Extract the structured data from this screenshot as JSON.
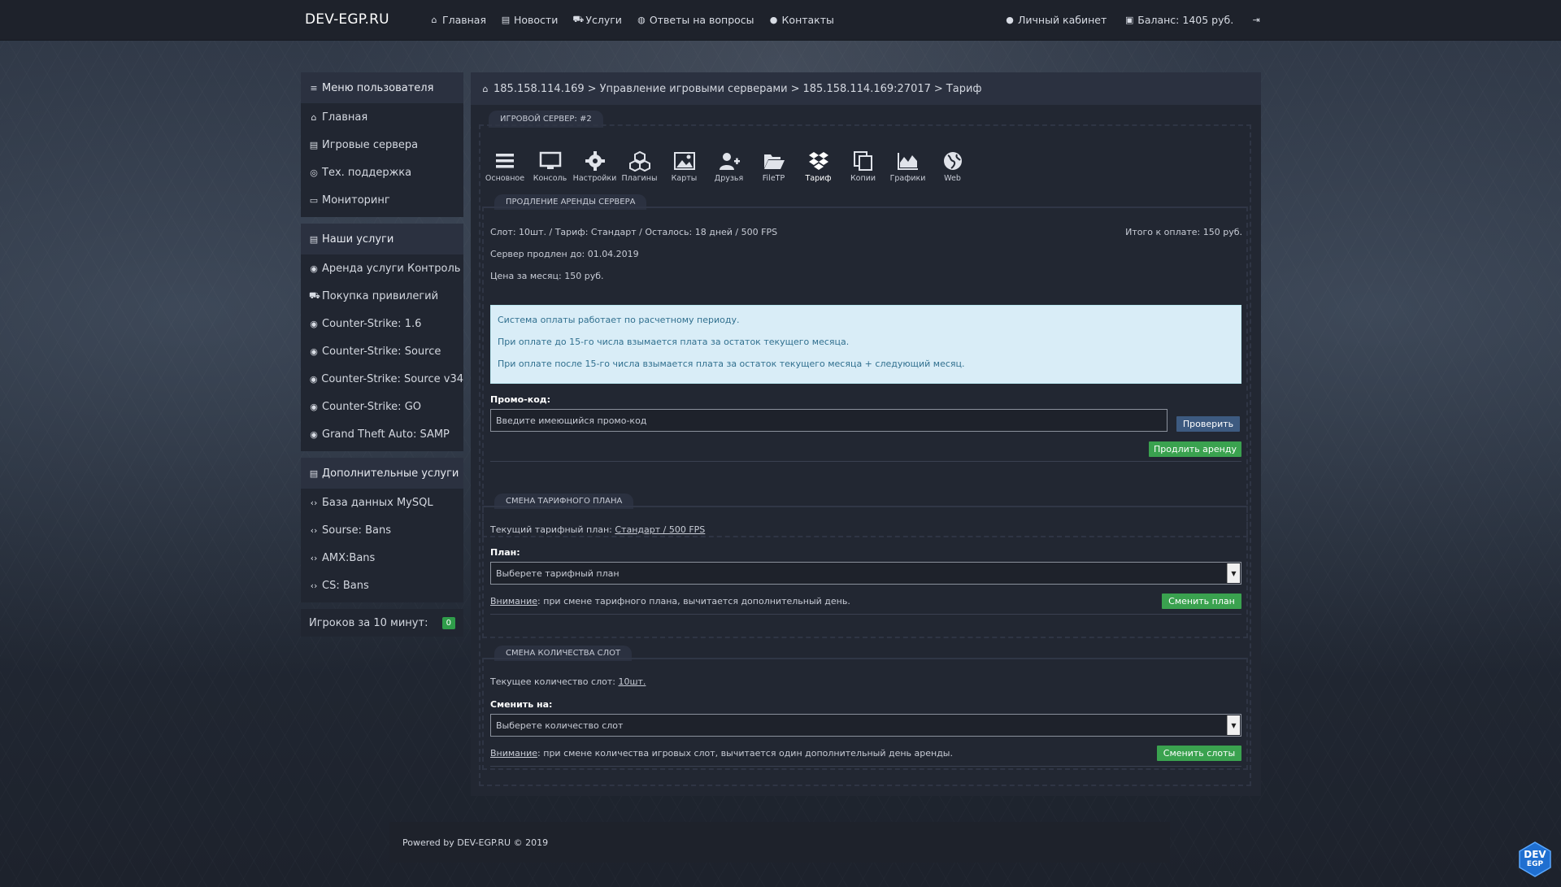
{
  "brand": "DEV-EGP.RU",
  "nav": {
    "left": [
      {
        "icon": "home-icon",
        "label": "Главная"
      },
      {
        "icon": "newspaper-icon",
        "label": "Новости"
      },
      {
        "icon": "cart-icon",
        "label": "Услуги"
      },
      {
        "icon": "globe-icon",
        "label": "Ответы на вопросы"
      },
      {
        "icon": "user-icon",
        "label": "Контакты"
      }
    ],
    "right": [
      {
        "icon": "user-icon",
        "label": "Личный кабинет"
      },
      {
        "icon": "money-icon",
        "label": "Баланс: 1405 руб."
      },
      {
        "icon": "logout-icon",
        "label": ""
      }
    ]
  },
  "sidebar": {
    "user_menu": {
      "title": "Меню пользователя",
      "items": [
        "Главная",
        "Игровые сервера",
        "Тех. поддержка",
        "Мониторинг"
      ]
    },
    "services": {
      "title": "Наши услуги",
      "items": [
        "Аренда услуги Контроль",
        "Покупка привилегий",
        "Counter-Strike: 1.6",
        "Counter-Strike: Source",
        "Counter-Strike: Source v34",
        "Counter-Strike: GO",
        "Grand Theft Auto: SAMP"
      ]
    },
    "extra": {
      "title": "Дополнительные услуги",
      "items": [
        "База данных MySQL",
        "Sourse: Bans",
        "AMX:Bans",
        "CS: Bans"
      ]
    },
    "online": {
      "label": "Игроков за 10 минут:",
      "count": "0"
    }
  },
  "breadcrumb": {
    "ip": "185.158.114.169",
    "sep1": ">",
    "section": "Управление игровыми серверами",
    "sep2": ">",
    "server": "185.158.114.169:27017",
    "sep3": ">",
    "page": "Тариф"
  },
  "server_tab": "ИГРОВОЙ СЕРВЕР: #2",
  "toolbar": [
    {
      "icon": "bars-icon",
      "label": "Основное"
    },
    {
      "icon": "monitor-icon",
      "label": "Консоль"
    },
    {
      "icon": "gear-icon",
      "label": "Настройки"
    },
    {
      "icon": "cubes-icon",
      "label": "Плагины"
    },
    {
      "icon": "image-icon",
      "label": "Карты"
    },
    {
      "icon": "user-plus-icon",
      "label": "Друзья"
    },
    {
      "icon": "folder-open-icon",
      "label": "FileTP"
    },
    {
      "icon": "dropbox-icon",
      "label": "Тариф"
    },
    {
      "icon": "copy-icon",
      "label": "Копии"
    },
    {
      "icon": "area-chart-icon",
      "label": "Графики"
    },
    {
      "icon": "globe-icon",
      "label": "Web"
    }
  ],
  "renew": {
    "title": "ПРОДЛЕНИЕ АРЕНДЫ СЕРВЕРА",
    "slot_info": "Слот: 10шт. / Тариф: Стандарт / Осталось: 18 дней / 500 FPS",
    "total": "Итого к оплате: 150 руб.",
    "extended_until": "Сервер продлен до: 01.04.2019",
    "monthly_price": "Цена за месяц: 150 руб.",
    "info_lines": [
      "Система оплаты работает по расчетному периоду.",
      "При оплате до 15-го числа взымается плата за остаток текущего месяца.",
      "При оплате после 15-го числа взымается плата за остаток текущего месяца + следующий месяц."
    ],
    "promo_label": "Промо-код:",
    "promo_placeholder": "Введите имеющийся промо-код",
    "check_button": "Проверить",
    "renew_button": "Продлить аренду"
  },
  "tariff": {
    "title": "СМЕНА ТАРИФНОГО ПЛАНА",
    "current_prefix": "Текущий тарифный план:",
    "current_value": "Стандарт / 500 FPS",
    "plan_label": "План:",
    "plan_select": "Выберете тарифный план",
    "warning_word": "Внимание",
    "warning_text": ": при смене тарифного плана, вычитается дополнительный день.",
    "button": "Сменить план"
  },
  "slots": {
    "title": "СМЕНА КОЛИЧЕСТВА СЛОТ",
    "current_prefix": "Текущее количество слот:",
    "current_value": "10шт.",
    "change_label": "Сменить на:",
    "select": "Выберете количество слот",
    "warning_word": "Внимание",
    "warning_text": ": при смене количества игровых слот, вычитается один дополнительный день аренды.",
    "button": "Сменить слоты"
  },
  "footer": "Powered by DEV-EGP.RU © 2019",
  "corner_logo": {
    "line1": "DEV",
    "line2": "EGP"
  },
  "colors": {
    "accent_green": "#3aa24f",
    "accent_blue": "#3d5a80",
    "info_bg": "#d9edf7"
  }
}
